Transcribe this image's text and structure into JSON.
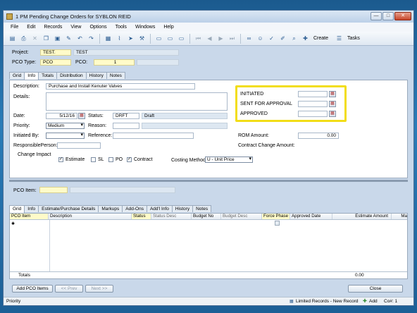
{
  "window": {
    "title": "1 PM Pending Change Orders for SYBLON REID",
    "controls": [
      "—",
      "□",
      "✕"
    ]
  },
  "menu": [
    "File",
    "Edit",
    "Records",
    "View",
    "Options",
    "Tools",
    "Windows",
    "Help"
  ],
  "toolbar": {
    "create_label": "Create",
    "tasks_label": "Tasks"
  },
  "header": {
    "project_label": "Project:",
    "project_code": "TEST.",
    "project_name": "TEST",
    "pco_type_label": "PCO Type:",
    "pco_type_value": "PCO",
    "pco_label": "PCO:",
    "pco_value": "1"
  },
  "top_tabs": [
    "Grid",
    "Info",
    "Totals",
    "Distribution",
    "History",
    "Notes"
  ],
  "info": {
    "description_label": "Description:",
    "description_value": "Purchase and Install Kenuter Valves",
    "details_label": "Details:",
    "date_label": "Date:",
    "date_value": "5/12/16",
    "status_label": "Status:",
    "status_code": "DRFT",
    "status_desc": "Draft",
    "priority_label": "Priority:",
    "priority_value": "Medium",
    "reason_label": "Reason:",
    "initiated_by_label": "Initiated By:",
    "reference_label": "Reference:",
    "responsible_label": "ResponsiblePerson:",
    "change_impact_label": "Change Impact",
    "estimate_label": "Estimate",
    "sl_label": "SL",
    "po_label": "PO",
    "contract_label": "Contract",
    "initiated_label": "INITIATED",
    "sent_label": "SENT FOR APPROVAL",
    "approved_label": "APPROVED",
    "rom_label": "ROM Amount:",
    "rom_value": "0.00",
    "cca_label": "Contract Change Amount:",
    "costing_label": "Costing Method",
    "costing_value": "U - Unit Price"
  },
  "pco_item_label": "PCO Item:",
  "bottom_tabs": [
    "Grid",
    "Info",
    "Estimate/Purchase Details",
    "Markups",
    "Add-Ons",
    "Add'l Info",
    "History",
    "Notes"
  ],
  "grid": {
    "columns": [
      "PCO Item",
      "Description",
      "Status",
      "Status Desc",
      "Budget No",
      "Budget Desc",
      "Force Phase",
      "Approved Date",
      "Estimate Amount",
      "Ma"
    ],
    "totals_label": "Totals",
    "totals_value": "0.00"
  },
  "buttons": {
    "add_items": "Add PCO Items",
    "prev": "<< Prev",
    "next": "Next >>",
    "close": "Close"
  },
  "status": {
    "left": "Priority",
    "records": "Limited Records - New Record",
    "add": "Add",
    "co": "Co#: 1"
  },
  "colors": {
    "highlight": "#f2dd18",
    "required_field": "#fffbc9"
  }
}
